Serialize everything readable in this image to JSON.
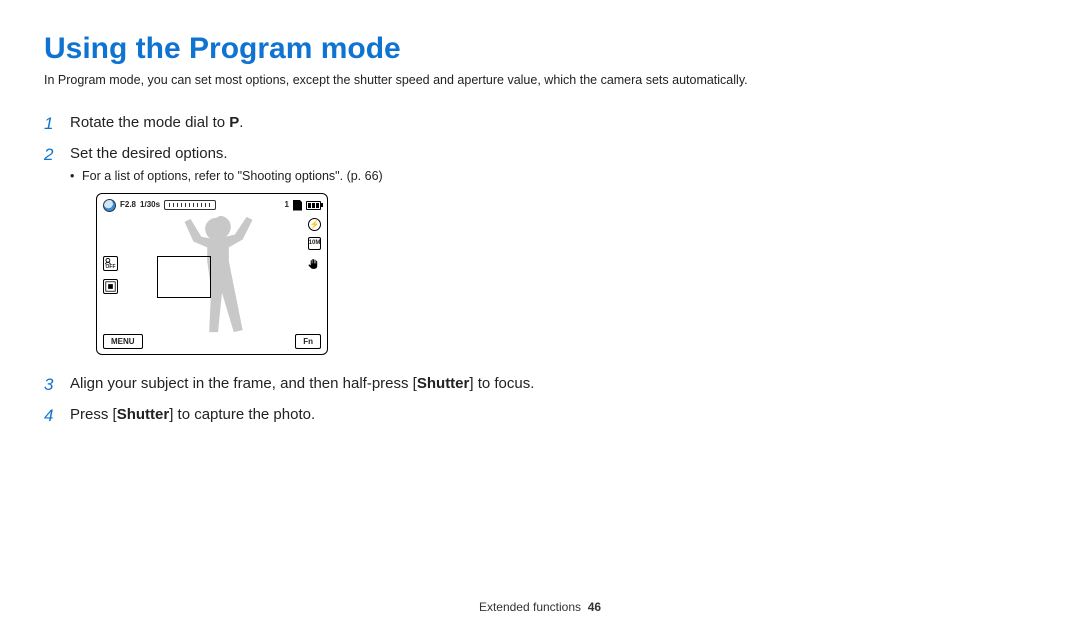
{
  "title": "Using the Program mode",
  "intro": "In Program mode, you can set most options, except the shutter speed and aperture value, which the camera sets automatically.",
  "steps": {
    "s1_pre": "Rotate the mode dial to ",
    "s1_mode": "P",
    "s1_post": ".",
    "s2": "Set the desired options.",
    "s2_sub": "For a list of options, refer to \"Shooting options\". (p. 66)",
    "s3_pre": "Align your subject in the frame, and then half-press [",
    "s3_btn": "Shutter",
    "s3_post": "] to focus.",
    "s4_pre": "Press [",
    "s4_btn": "Shutter",
    "s4_post": "] to capture the photo."
  },
  "lcd": {
    "aperture": "F2.8",
    "shutter": "1/30s",
    "count": "1",
    "menu": "MENU",
    "fn": "Fn",
    "off": "OFF",
    "tenm": "10M",
    "flash": "$"
  },
  "footer": {
    "section": "Extended functions",
    "page": "46"
  }
}
